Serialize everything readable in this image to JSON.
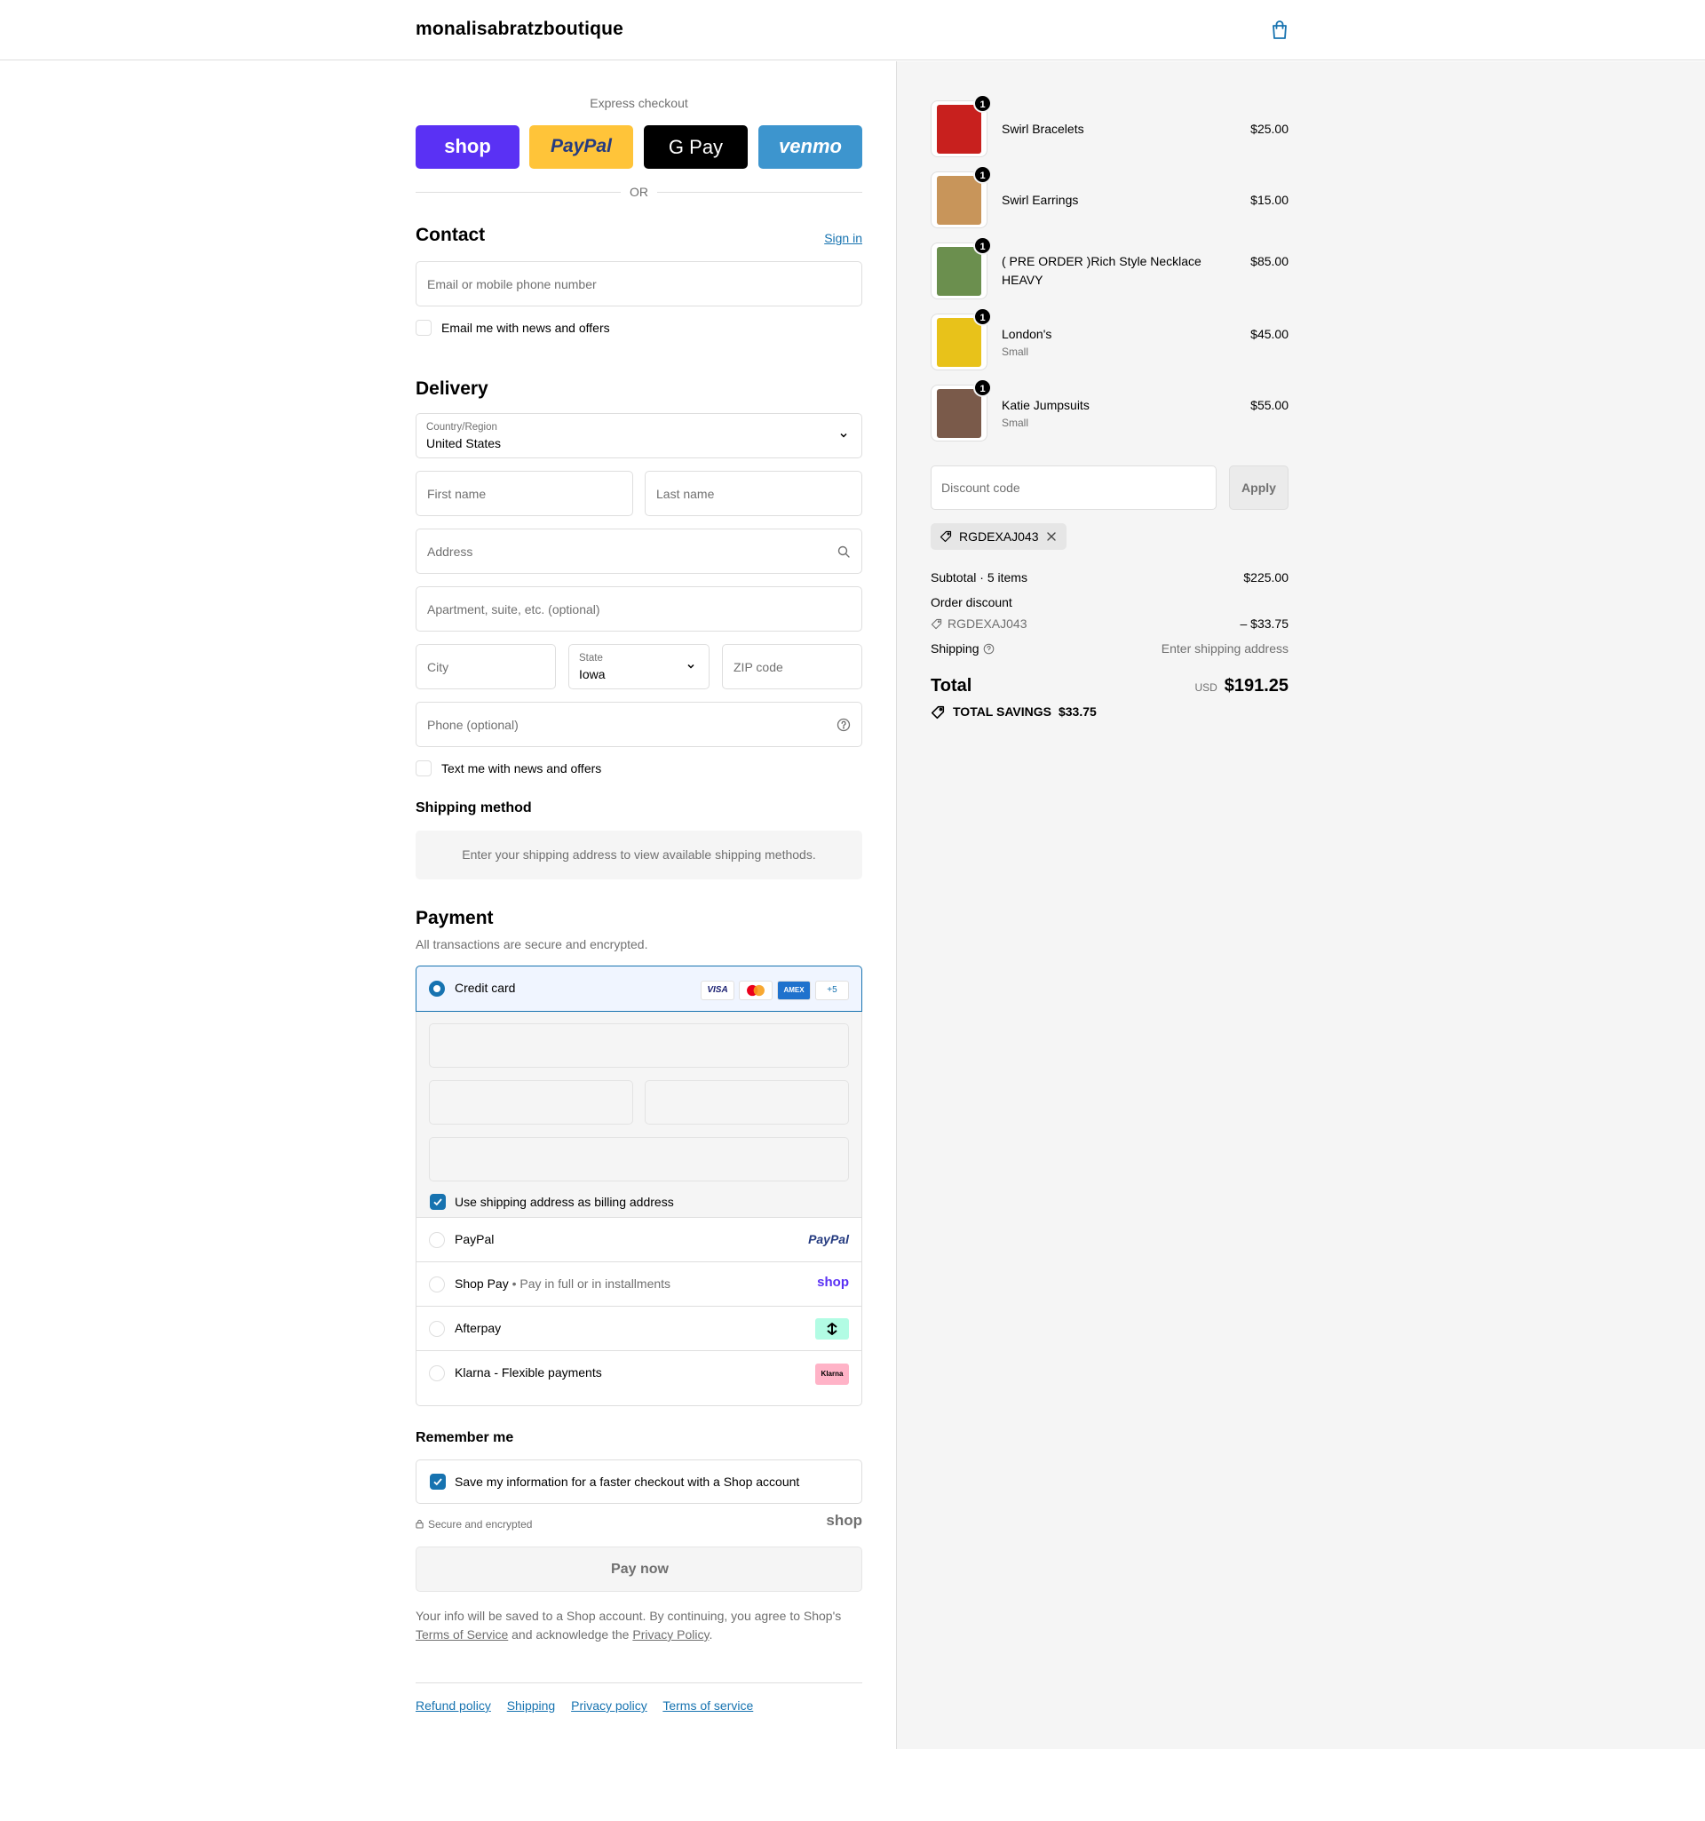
{
  "header": {
    "brand": "monalisabratzboutique"
  },
  "express": {
    "title": "Express checkout",
    "buttons": [
      {
        "label": "shop",
        "color": "#5a31f4"
      },
      {
        "label": "PayPal",
        "color": "#ffc439"
      },
      {
        "label": "G Pay",
        "color": "#000000"
      },
      {
        "label": "venmo",
        "color": "#3d95ce"
      }
    ],
    "or": "OR"
  },
  "contact": {
    "title": "Contact",
    "sign_in": "Sign in",
    "email_placeholder": "Email or mobile phone number",
    "email_news": "Email me with news and offers"
  },
  "delivery": {
    "title": "Delivery",
    "country_label": "Country/Region",
    "country_value": "United States",
    "first_name": "First name",
    "last_name": "Last name",
    "address": "Address",
    "apartment": "Apartment, suite, etc. (optional)",
    "city": "City",
    "state_label": "State",
    "state_value": "Iowa",
    "zip": "ZIP code",
    "phone": "Phone (optional)",
    "text_news": "Text me with news and offers"
  },
  "shipping_method": {
    "title": "Shipping method",
    "notice": "Enter your shipping address to view available shipping methods."
  },
  "payment": {
    "title": "Payment",
    "subtitle": "All transactions are secure and encrypted.",
    "credit_card": "Credit card",
    "card_brands": [
      "VISA",
      "MC",
      "AMEX",
      "+5"
    ],
    "billing_same": "Use shipping address as billing address",
    "options": [
      {
        "label": "PayPal",
        "sub": "",
        "logo": "PayPal"
      },
      {
        "label": "Shop Pay",
        "sub": "Pay in full or in installments",
        "logo": "shop"
      },
      {
        "label": "Afterpay",
        "sub": "",
        "logo": "afterpay-icon"
      },
      {
        "label": "Klarna - Flexible payments",
        "sub": "",
        "logo": "Klarna"
      }
    ]
  },
  "remember": {
    "title": "Remember me",
    "save_info": "Save my information for a faster checkout with a Shop account",
    "secure": "Secure and encrypted",
    "shop_logo": "shop"
  },
  "pay_now": "Pay now",
  "legal": {
    "line1": "Your info will be saved to a Shop account. By continuing, you agree to Shop's",
    "terms": "Terms of Service",
    "and": "and acknowledge the",
    "privacy": "Privacy Policy",
    "period": "."
  },
  "footer_links": [
    "Refund policy",
    "Shipping",
    "Privacy policy",
    "Terms of service"
  ],
  "summary": {
    "items": [
      {
        "name": "Swirl Bracelets",
        "variant": "",
        "price": "$25.00",
        "qty": "1",
        "thumb_color": "#c8201e"
      },
      {
        "name": "Swirl Earrings",
        "variant": "",
        "price": "$15.00",
        "qty": "1",
        "thumb_color": "#c8955a"
      },
      {
        "name": "( PRE ORDER )Rich Style Necklace HEAVY",
        "variant": "",
        "price": "$85.00",
        "qty": "1",
        "thumb_color": "#6b8f4e"
      },
      {
        "name": "London's",
        "variant": "Small",
        "price": "$45.00",
        "qty": "1",
        "thumb_color": "#e8c21a"
      },
      {
        "name": "Katie Jumpsuits",
        "variant": "Small",
        "price": "$55.00",
        "qty": "1",
        "thumb_color": "#7a5a4a"
      }
    ],
    "discount_placeholder": "Discount code",
    "apply": "Apply",
    "applied_code": "RGDEXAJ043",
    "subtotal_label": "Subtotal · 5 items",
    "subtotal_value": "$225.00",
    "order_discount": "Order discount",
    "discount_code": "RGDEXAJ043",
    "discount_value": "– $33.75",
    "shipping_label": "Shipping",
    "shipping_value": "Enter shipping address",
    "total_label": "Total",
    "currency": "USD",
    "total_value": "$191.25",
    "savings_label": "TOTAL SAVINGS",
    "savings_value": "$33.75"
  },
  "colors": {
    "accent": "#1773b0",
    "panel": "#f5f5f5",
    "border": "#dedede"
  }
}
